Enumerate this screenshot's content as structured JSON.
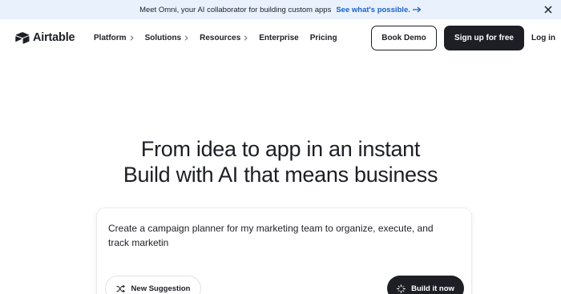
{
  "banner": {
    "message": "Meet Omni, your AI collaborator for building custom apps",
    "cta": "See what's possible."
  },
  "nav": {
    "logo_text": "Airtable",
    "items": [
      {
        "label": "Platform",
        "has_chevron": true
      },
      {
        "label": "Solutions",
        "has_chevron": true
      },
      {
        "label": "Resources",
        "has_chevron": true
      },
      {
        "label": "Enterprise",
        "has_chevron": false
      },
      {
        "label": "Pricing",
        "has_chevron": false
      }
    ],
    "book_demo": "Book Demo",
    "signup": "Sign up for free",
    "login": "Log in"
  },
  "hero": {
    "line1": "From idea to app in an instant",
    "line2": "Build with AI that means business"
  },
  "prompt": {
    "text": "Create a campaign planner for my marketing team to organize, execute, and track marketin",
    "suggestion_button": "New Suggestion",
    "build_button": "Build it now"
  },
  "colors": {
    "banner_bg": "#e9f1fc",
    "link_blue": "#1b61c9",
    "dark": "#1d1f25"
  }
}
